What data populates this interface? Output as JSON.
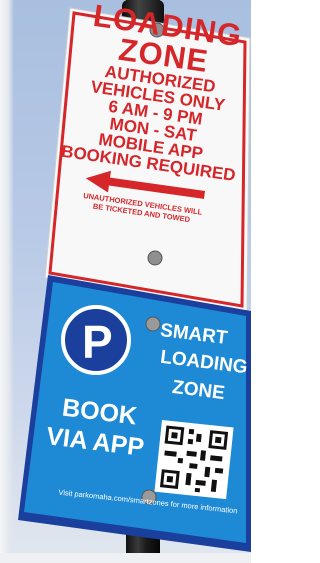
{
  "loading_zone_sign": {
    "title_line1": "LOADING",
    "title_line2": "ZONE",
    "body_lines": [
      "AUTHORIZED",
      "VEHICLES ONLY",
      "6 AM - 9 PM",
      "MON - SAT",
      "MOBILE APP",
      "BOOKING REQUIRED"
    ],
    "fine_print_line1": "UNAUTHORIZED VEHICLES WILL",
    "fine_print_line2": "BE TICKETED AND TOWED",
    "text_color": "#d5262a",
    "arrow_icon": "left-arrow-icon"
  },
  "smart_loading_sign": {
    "parking_letter": "P",
    "heading_line1": "SMART",
    "heading_line2": "LOADING",
    "heading_line3": "ZONE",
    "book_line1": "BOOK",
    "book_line2": "VIA APP",
    "footer_text": "Visit parkomaha.com/smartzones for more information",
    "background_color": "#1e8ad6",
    "border_color": "#1a3f9c",
    "qr_icon": "qr-code-icon"
  },
  "colors": {
    "sky": "#b7c9e6",
    "pole": "#1a1a1a"
  }
}
